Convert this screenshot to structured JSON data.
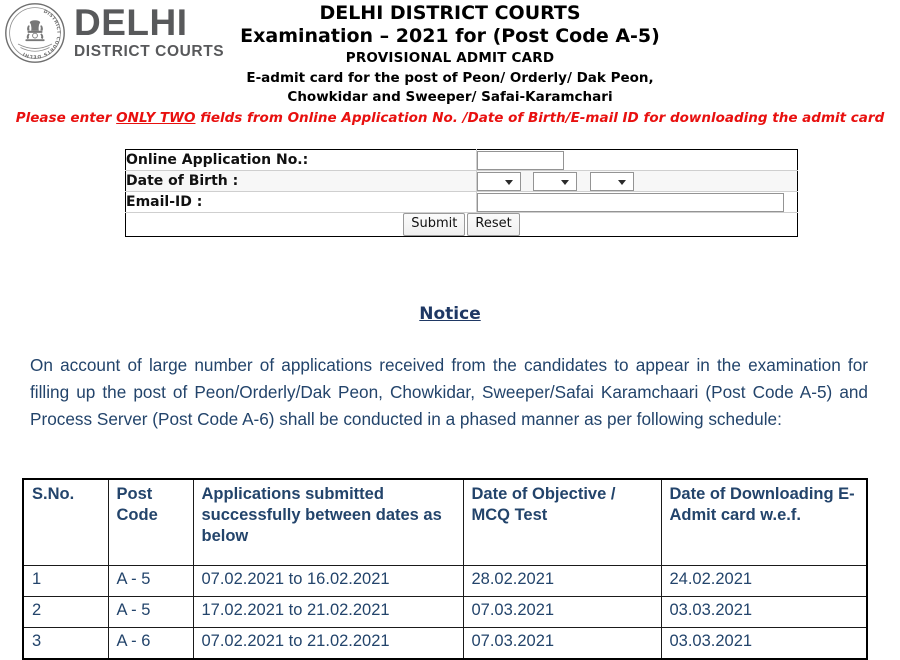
{
  "logo": {
    "seal_alt": "delhi-district-courts-seal",
    "seal_ring_text": "DISTRICT COURTS DELHI",
    "primary": "DELHI",
    "secondary": "DISTRICT COURTS"
  },
  "header": {
    "line1": "DELHI DISTRICT COURTS",
    "line2": "Examination – 2021 for (Post Code A-5)",
    "line3": "PROVISIONAL ADMIT CARD",
    "line4": "E-admit card for the post of Peon/ Orderly/ Dak Peon,",
    "line5": "Chowkidar and Sweeper/ Safai-Karamchari",
    "warning_before": "Please enter ",
    "warning_emphasis": "ONLY TWO",
    "warning_after": " fields from Online Application No. /Date of Birth/E-mail ID for downloading the admit card",
    "warning_color": "#e8100f"
  },
  "form": {
    "fields": [
      {
        "label": "Online Application No.:",
        "value": "",
        "placeholder": ""
      },
      {
        "label": "Date of Birth :",
        "value": "",
        "placeholder": ""
      },
      {
        "label": "Email-ID :",
        "value": "",
        "placeholder": ""
      }
    ],
    "dob_selects": [
      {
        "name": "day",
        "selected": ""
      },
      {
        "name": "month",
        "selected": ""
      },
      {
        "name": "year",
        "selected": ""
      }
    ],
    "submit_label": "Submit",
    "reset_label": "Reset"
  },
  "notice": {
    "link_label": "Notice",
    "link_color": "#1f3864"
  },
  "body": {
    "paragraph": "On account of large number of applications received from the candidates to appear in the examination for filling up the post of Peon/Orderly/Dak Peon, Chowkidar, Sweeper/Safai Karamchaari (Post Code A-5) and Process Server (Post Code A-6) shall be conducted in a phased manner as per following schedule:",
    "text_color": "#23446b"
  },
  "schedule_table": {
    "headers": [
      "S.No.",
      "Post Code",
      "Applications submitted successfully between dates as below",
      "Date of Objective / MCQ Test",
      "Date of Downloading E-Admit card w.e.f."
    ],
    "rows": [
      [
        "1",
        "A - 5",
        "07.02.2021 to 16.02.2021",
        "28.02.2021",
        "24.02.2021"
      ],
      [
        "2",
        "A - 5",
        "17.02.2021 to 21.02.2021",
        "07.03.2021",
        "03.03.2021"
      ],
      [
        "3",
        "A - 6",
        "07.02.2021 to 21.02.2021",
        "07.03.2021",
        "03.03.2021"
      ]
    ]
  }
}
